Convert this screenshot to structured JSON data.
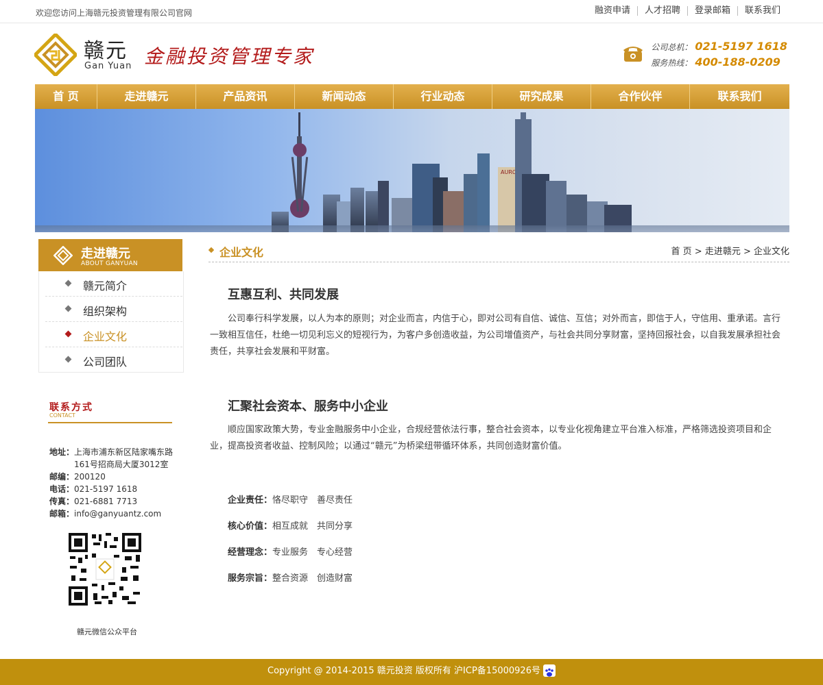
{
  "topbar": {
    "welcome": "欢迎您访问上海赣元投资管理有限公司官网",
    "links": [
      "融资申请",
      "人才招聘",
      "登录邮箱",
      "联系我们"
    ]
  },
  "header": {
    "brand_cn": "赣元",
    "brand_en": "Gan Yuan",
    "slogan": "金融投资管理专家",
    "phone_label_1": "公司总机：",
    "phone_1": "021-5197 1618",
    "phone_label_2": "服务热线：",
    "phone_2": "400-188-0209"
  },
  "nav": [
    "首 页",
    "走进赣元",
    "产品资讯",
    "新闻动态",
    "行业动态",
    "研究成果",
    "合作伙伴",
    "联系我们"
  ],
  "banner": {
    "building_sign": "AURORA"
  },
  "sidebar": {
    "title": "走进赣元",
    "subtitle": "ABOUT GANYUAN",
    "items": [
      {
        "label": "赣元简介"
      },
      {
        "label": "组织架构"
      },
      {
        "label": "企业文化"
      },
      {
        "label": "公司团队"
      }
    ],
    "active_index": 2
  },
  "contact": {
    "title": "联系方式",
    "subtitle": "CONTACT",
    "address_label": "地址：",
    "address_1": "上海市浦东新区陆家嘴东路",
    "address_2": "161号招商局大厦3012室",
    "postcode_label": "邮编：",
    "postcode": "200120",
    "phone_label": "电话：",
    "phone": "021-5197 1618",
    "fax_label": "传真：",
    "fax": "021-6881 7713",
    "email_label": "邮箱：",
    "email": "info@ganyuantz.com",
    "qr_caption": "赣元微信公众平台"
  },
  "main": {
    "title": "企业文化",
    "breadcrumb": "首 页 > 走进赣元 > 企业文化",
    "section1_title": "互惠互利、共同发展",
    "section1_text": "公司奉行科学发展，以人为本的原则；对企业而言，内信于心，即对公司有自信、诚信、互信；对外而言，即信于人，守信用、重承诺。言行一致相互信任，杜绝一切见利忘义的短视行为，为客户多创造收益，为公司增值资产，与社会共同分享财富，坚持回报社会，以自我发展承担社会责任，共享社会发展和平财富。",
    "section2_title": "汇聚社会资本、服务中小企业",
    "section2_text": "顺应国家政策大势，专业金融服务中小企业，合规经营依法行事，整合社会资本，以专业化视角建立平台准入标准，严格筛选投资项目和企业，提高投资者收益、控制风险；以通过“赣元”为桥梁纽带循环体系，共同创造财富价值。",
    "values": [
      {
        "key": "企业责任：",
        "value": "恪尽职守　善尽责任"
      },
      {
        "key": "核心价值：",
        "value": "相互成就　共同分享"
      },
      {
        "key": "经营理念：",
        "value": "专业服务　专心经营"
      },
      {
        "key": "服务宗旨：",
        "value": "整合资源　创造财富"
      }
    ]
  },
  "footer": {
    "text": "Copyright @ 2014-2015 赣元投资 版权所有 沪ICP备15000926号"
  },
  "colors": {
    "gold": "#c99125",
    "red": "#b31b1b",
    "footer": "#c0900d",
    "phone_orange": "#d48a00"
  },
  "icons": [
    "gan-yuan-logo-icon",
    "telephone-icon",
    "diamond-bullet-icon",
    "qr-code",
    "baidu-paw-icon"
  ]
}
